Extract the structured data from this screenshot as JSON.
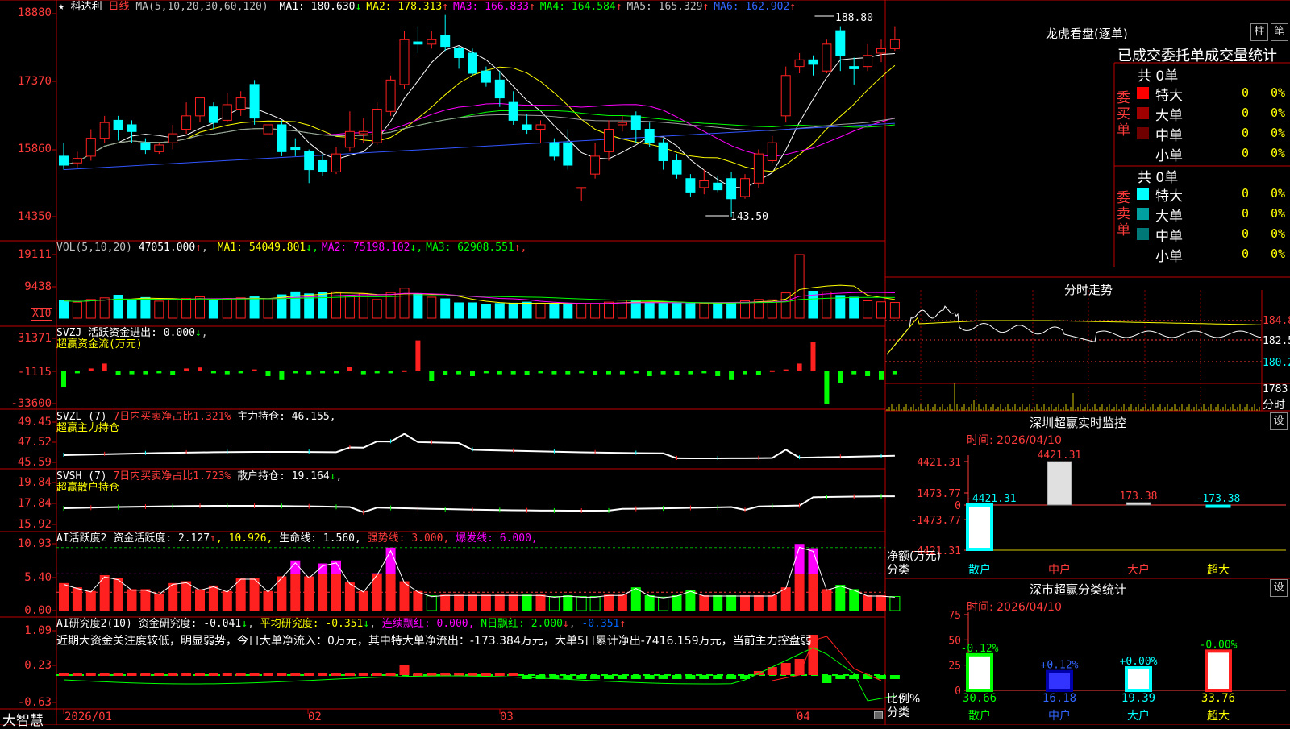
{
  "header": {
    "star": "★",
    "name": "科达利",
    "period": "日线",
    "ma_label": "MA(5,10,20,30,60,120)",
    "ma": [
      {
        "label": "MA1:",
        "value": "180.630",
        "arrow": "↓",
        "color": "#ffffff"
      },
      {
        "label": "MA2:",
        "value": "178.313",
        "arrow": "↑",
        "color": "#ffff00"
      },
      {
        "label": "MA3:",
        "value": "166.833",
        "arrow": "↑",
        "color": "#ff00ff"
      },
      {
        "label": "MA4:",
        "value": "164.584",
        "arrow": "↑",
        "color": "#00ff00"
      },
      {
        "label": "MA5:",
        "value": "165.329",
        "arrow": "↑",
        "color": "#c0c0c0"
      },
      {
        "label": "MA6:",
        "value": "162.902",
        "arrow": "↑",
        "color": "#3366ff"
      }
    ]
  },
  "panels": {
    "price": {
      "ticks": [
        "18880",
        "17370",
        "15860",
        "14350"
      ],
      "high_label": "188.80",
      "low_label": "143.50"
    },
    "vol": {
      "ticks": [
        "19111",
        "9438"
      ],
      "unit": "X10",
      "title": "VOL(5,10,20)",
      "value": "47051.000",
      "value_arrow": "↑",
      "ma": [
        {
          "label": "MA1:",
          "value": "54049.801",
          "arrow": "↓",
          "color": "#ffff00"
        },
        {
          "label": "MA2:",
          "value": "75198.102",
          "arrow": "↓",
          "color": "#ff00ff"
        },
        {
          "label": "MA3:",
          "value": "62908.551",
          "arrow": "↑",
          "color": "#00ff00"
        }
      ]
    },
    "svzj": {
      "ticks": [
        "31371",
        "-1115",
        "-33600"
      ],
      "line1": "SVZJ  活跃资金进出: 0.000",
      "line1_arrow": "↓",
      "line2": "超赢资金流(万元)"
    },
    "svzl": {
      "ticks": [
        "49.45",
        "47.52",
        "45.59"
      ],
      "line1_a": "SVZL (7)",
      "line1_b": "7日内买卖净占比1.321%",
      "line1_c": "主力持仓: 46.155,",
      "line2": "超赢主力持仓"
    },
    "svsh": {
      "ticks": [
        "19.84",
        "17.84",
        "15.92"
      ],
      "line1_a": "SVSH (7)",
      "line1_b": "7日内买卖净占比1.723%",
      "line1_c": "散户持仓: 19.164",
      "line1_arrow": "↓",
      "line2": "超赢散户持仓"
    },
    "ai": {
      "ticks": [
        "10.93",
        "5.40",
        "0.00"
      ],
      "a": "AI活跃度2",
      "b": "资金活跃度: 2.127",
      "c": ", 10.926,",
      "d": "生命线: 1.560,",
      "e": "强势线: 3.000,",
      "f": "爆发线: 6.000,"
    },
    "res": {
      "ticks": [
        "1.09",
        "0.23",
        "-0.63"
      ],
      "a": "AI研究度2(10)",
      "b": "资金研究度: -0.041",
      "c": "平均研究度: -0.351",
      "d": "连续飘红: 0.000,",
      "e": "N日飘红: 2.000",
      "f": "-0.351",
      "comment": "近期大资金关注度较低，明显弱势，今日大单净流入：0万元，其中特大单净流出：-173.384万元，大单5日累计净出-7416.159万元，当前主力控盘弱"
    }
  },
  "xaxis": {
    "brand": "大智慧",
    "labels": [
      "2026/01",
      "02",
      "03",
      "04"
    ]
  },
  "right": {
    "lhb_title": "龙虎看盘(逐单)",
    "btn_zhu": "柱",
    "btn_bi": "笔",
    "stat_title": "已成交委托单成交量统计",
    "buy_side": "委买单",
    "sell_side": "委卖单",
    "buy_total": "共 0单",
    "sell_total": "共 0单",
    "buy_rows": [
      {
        "label": "特大",
        "count": "0",
        "pct": "0%",
        "color": "#ff0000"
      },
      {
        "label": "大单",
        "count": "0",
        "pct": "0%",
        "color": "#a00000"
      },
      {
        "label": "中单",
        "count": "0",
        "pct": "0%",
        "color": "#700000"
      },
      {
        "label": "小单",
        "count": "0",
        "pct": "0%",
        "color": ""
      }
    ],
    "sell_rows": [
      {
        "label": "特大",
        "count": "0",
        "pct": "0%",
        "color": "#00ffff"
      },
      {
        "label": "大单",
        "count": "0",
        "pct": "0%",
        "color": "#00a0a0"
      },
      {
        "label": "中单",
        "count": "0",
        "pct": "0%",
        "color": "#007878"
      },
      {
        "label": "小单",
        "count": "0",
        "pct": "0%",
        "color": ""
      }
    ],
    "intraday_title": "分时走势",
    "intraday_ticks": [
      "184.8",
      "182.5",
      "180.2"
    ],
    "intraday_vol": "1783",
    "intraday_vol_unit": "分时",
    "sz_title": "深圳超赢实时监控",
    "sz_btn": "设",
    "sz_time": "时间: 2026/04/10",
    "sz_ticks": [
      "4421.31",
      "1473.77",
      "0",
      "-1473.77",
      "-4421.31"
    ],
    "sz_ylabel1": "净额(万元)",
    "sz_ylabel2": "分类",
    "sz_cats": [
      "散户",
      "中户",
      "大户",
      "超大"
    ],
    "sz_values": [
      "-4421.31",
      "4421.31",
      "173.38",
      "-173.38"
    ],
    "ss_title": "深市超赢分类统计",
    "ss_btn": "设",
    "ss_time": "时间: 2026/04/10",
    "ss_ticks": [
      "75",
      "50",
      "25",
      "0"
    ],
    "ss_ylabel1": "比例%",
    "ss_ylabel2": "分类",
    "ss_cats": [
      "散户",
      "中户",
      "大户",
      "超大"
    ],
    "ss_pct": [
      "30.66",
      "16.18",
      "19.39",
      "33.76"
    ],
    "ss_change": [
      "-0.12%",
      "+0.12%",
      "+0.00%",
      "-0.00%"
    ]
  },
  "chart_data": {
    "type": "candlestick",
    "price_axis": [
      14350,
      18880
    ],
    "candles": [
      [
        157.0,
        155.0,
        160.0,
        154.0
      ],
      [
        155.5,
        156.5,
        158.0,
        154.5
      ],
      [
        157.0,
        161.0,
        163.0,
        156.0
      ],
      [
        161.0,
        164.5,
        166.0,
        160.0
      ],
      [
        165.0,
        163.0,
        166.0,
        160.5
      ],
      [
        164.0,
        162.5,
        165.0,
        160.0
      ],
      [
        160.0,
        158.5,
        161.0,
        157.5
      ],
      [
        158.0,
        159.5,
        160.0,
        157.5
      ],
      [
        160.0,
        162.0,
        164.0,
        158.5
      ],
      [
        163.0,
        166.0,
        169.0,
        162.0
      ],
      [
        166.0,
        170.0,
        170.0,
        164.5
      ],
      [
        168.0,
        164.5,
        169.0,
        163.0
      ],
      [
        165.0,
        168.5,
        171.0,
        164.5
      ],
      [
        167.5,
        170.0,
        171.5,
        166.0
      ],
      [
        173.0,
        165.5,
        174.0,
        164.0
      ],
      [
        162.0,
        164.0,
        164.5,
        160.0
      ],
      [
        164.0,
        158.0,
        165.0,
        157.0
      ],
      [
        159.0,
        158.5,
        161.0,
        157.0
      ],
      [
        158.0,
        154.0,
        158.5,
        151.0
      ],
      [
        156.0,
        153.5,
        157.5,
        152.5
      ],
      [
        153.5,
        157.5,
        159.0,
        153.0
      ],
      [
        159.0,
        162.5,
        167.0,
        158.0
      ],
      [
        162.0,
        162.5,
        165.5,
        160.0
      ],
      [
        160.0,
        167.5,
        169.0,
        159.5
      ],
      [
        167.0,
        174.0,
        175.0,
        166.0
      ],
      [
        173.0,
        183.0,
        185.0,
        172.0
      ],
      [
        182.5,
        182.0,
        186.0,
        180.0
      ],
      [
        182.0,
        183.0,
        185.0,
        181.0
      ],
      [
        184.0,
        181.5,
        188.5,
        180.5
      ],
      [
        181.0,
        179.0,
        181.5,
        176.5
      ],
      [
        180.0,
        175.5,
        181.0,
        175.0
      ],
      [
        176.0,
        173.5,
        177.0,
        172.5
      ],
      [
        174.0,
        170.0,
        176.0,
        168.0
      ],
      [
        169.0,
        165.0,
        171.5,
        164.0
      ],
      [
        164.0,
        163.0,
        166.5,
        162.0
      ],
      [
        163.0,
        164.0,
        165.0,
        160.0
      ],
      [
        160.0,
        157.0,
        161.0,
        156.0
      ],
      [
        160.0,
        155.0,
        163.0,
        154.0
      ],
      [
        150.0,
        150.0,
        150.0,
        147.0
      ],
      [
        153.0,
        157.0,
        160.0,
        152.0
      ],
      [
        158.0,
        163.0,
        165.0,
        156.0
      ],
      [
        164.0,
        164.5,
        166.0,
        162.5
      ],
      [
        166.0,
        163.0,
        167.0,
        160.0
      ],
      [
        163.0,
        160.0,
        164.5,
        159.0
      ],
      [
        160.0,
        156.0,
        161.0,
        154.0
      ],
      [
        156.0,
        153.0,
        157.5,
        152.0
      ],
      [
        152.0,
        149.0,
        153.0,
        148.0
      ],
      [
        150.0,
        151.5,
        154.0,
        148.5
      ],
      [
        151.0,
        149.5,
        152.5,
        149.0
      ],
      [
        152.0,
        147.5,
        153.5,
        143.5
      ],
      [
        148.0,
        152.0,
        153.0,
        147.5
      ],
      [
        151.0,
        157.5,
        158.5,
        150.0
      ],
      [
        156.0,
        160.0,
        161.5,
        155.5
      ],
      [
        166.0,
        175.0,
        177.0,
        164.5
      ],
      [
        177.0,
        178.5,
        180.0,
        175.5
      ],
      [
        178.5,
        177.5,
        179.5,
        175.0
      ],
      [
        176.0,
        182.0,
        183.0,
        175.5
      ],
      [
        185.0,
        179.5,
        186.0,
        176.0
      ],
      [
        177.0,
        176.5,
        179.0,
        173.0
      ],
      [
        177.0,
        179.5,
        182.0,
        176.0
      ],
      [
        180.0,
        181.0,
        183.0,
        178.0
      ],
      [
        181.0,
        183.0,
        186.0,
        180.5
      ]
    ],
    "volume_axis": [
      0,
      19111
    ],
    "volume": [
      5200,
      4800,
      5600,
      6100,
      6900,
      5300,
      6200,
      5100,
      5800,
      5900,
      6400,
      5200,
      5900,
      6100,
      6400,
      5800,
      7000,
      7900,
      7300,
      7800,
      7900,
      6800,
      7400,
      5600,
      7700,
      9000,
      7100,
      6300,
      5800,
      4600,
      4600,
      4100,
      4400,
      4500,
      4800,
      4500,
      4200,
      4300,
      4300,
      4400,
      4800,
      5400,
      5100,
      4700,
      4600,
      4500,
      4400,
      4500,
      4600,
      4700,
      5200,
      5600,
      5500,
      7600,
      19111,
      8100,
      7900,
      6800,
      6300,
      5200,
      4900,
      4705
    ]
  }
}
